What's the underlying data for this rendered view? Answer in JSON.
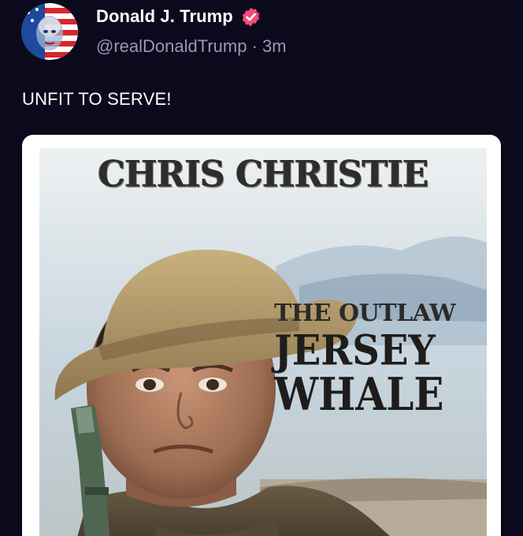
{
  "post": {
    "author": {
      "display_name": "Donald J. Trump",
      "handle": "@realDonaldTrump",
      "separator": " · ",
      "timestamp": "3m",
      "verified": true
    },
    "text": "UNFIT TO SERVE!",
    "media": {
      "poster_title": "CHRIS CHRISTIE",
      "tagline_line1": "THE OUTLAW",
      "tagline_line2": "JERSEY",
      "tagline_line3": "WHALE"
    }
  },
  "colors": {
    "background": "#0b0a1c",
    "text_primary": "#ffffff",
    "text_secondary": "#9a98b0",
    "verified_badge": "#f5497a",
    "card_border": "#ffffff"
  },
  "icons": {
    "verified": "verified-badge-icon"
  }
}
